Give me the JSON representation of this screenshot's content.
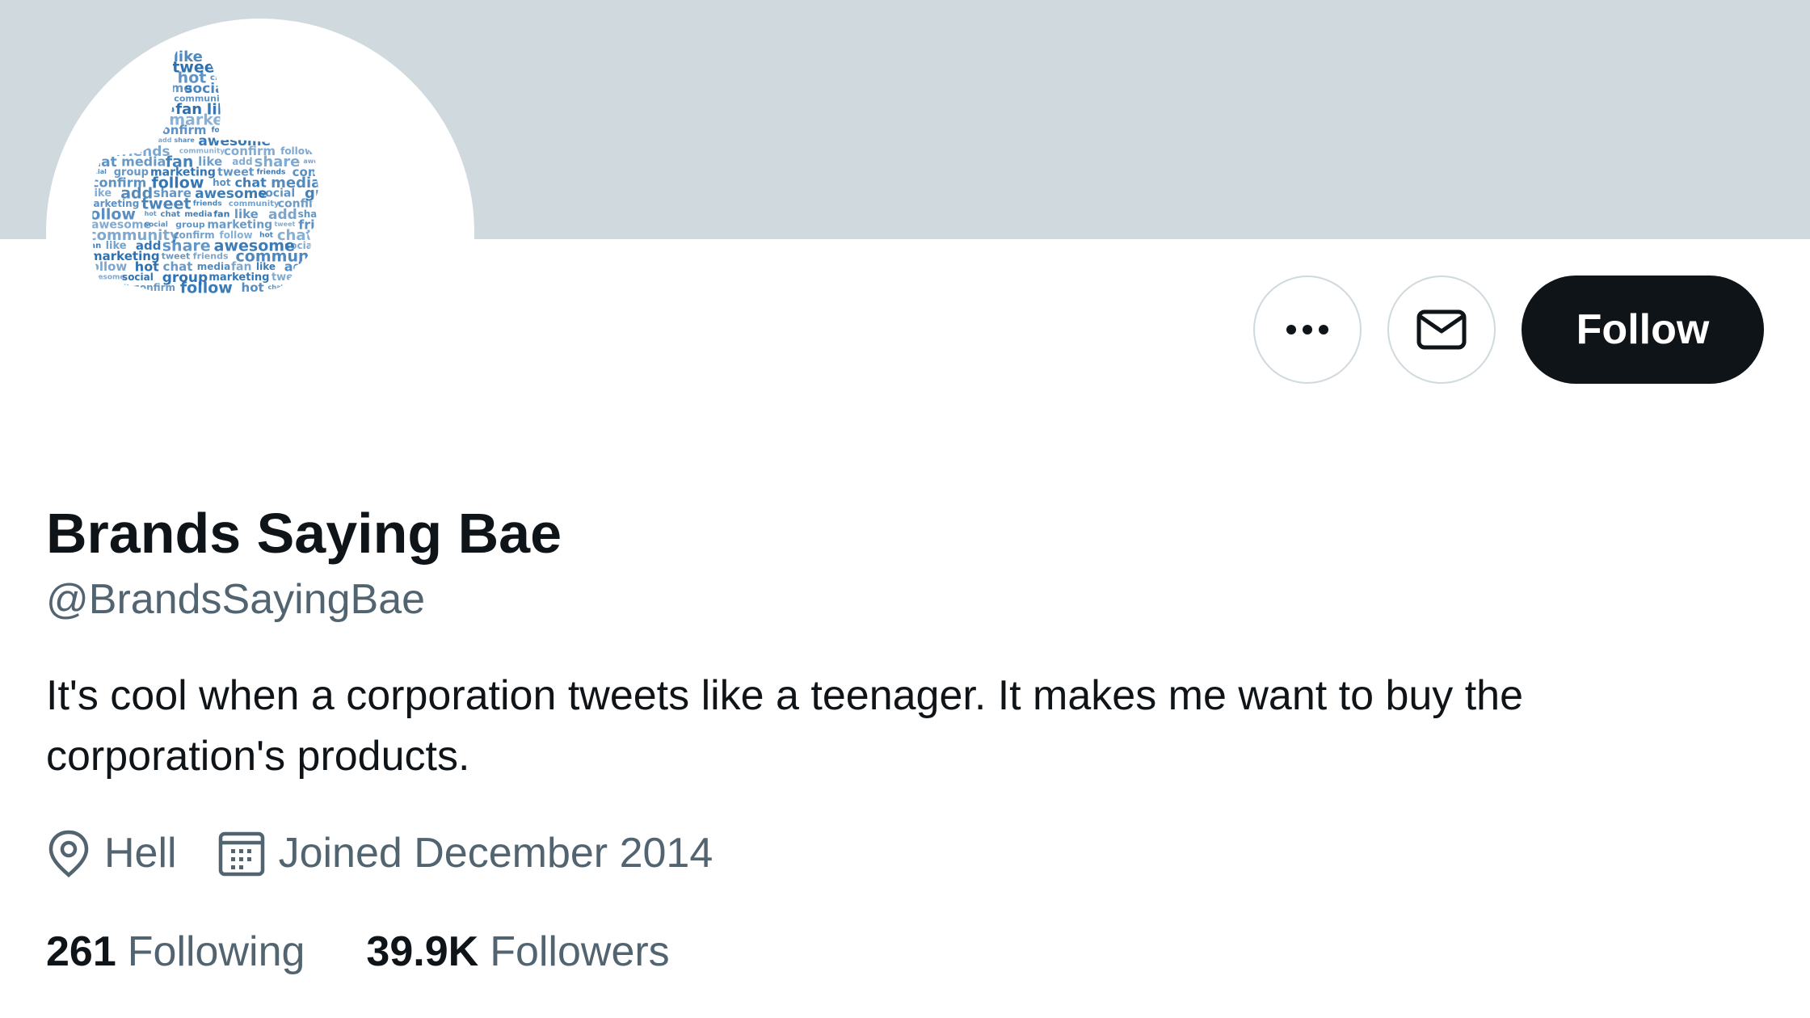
{
  "profile": {
    "display_name": "Brands Saying Bae",
    "handle": "@BrandsSayingBae",
    "bio": "It's cool when a corporation tweets like a teenager. It makes me want to buy the corporation's products.",
    "location": "Hell",
    "joined": "Joined December 2014"
  },
  "actions": {
    "more_icon": "more-horizontal-icon",
    "message_icon": "envelope-icon",
    "follow_label": "Follow"
  },
  "stats": {
    "following_count": "261",
    "following_label": "Following",
    "followers_count": "39.9K",
    "followers_label": "Followers"
  },
  "avatar": {
    "icon": "thumbs-up-word-cloud",
    "words": [
      "chat",
      "media",
      "fan",
      "like",
      "add",
      "share",
      "awesome",
      "social",
      "group",
      "marketing",
      "tweet",
      "friends",
      "community",
      "confirm",
      "follow",
      "hot"
    ]
  },
  "colors": {
    "banner": "#cfd9de",
    "follow_button": "#0f1419",
    "secondary_text": "#536471",
    "primary_text": "#0f1419",
    "word_cloud": "#2a6fb0"
  }
}
